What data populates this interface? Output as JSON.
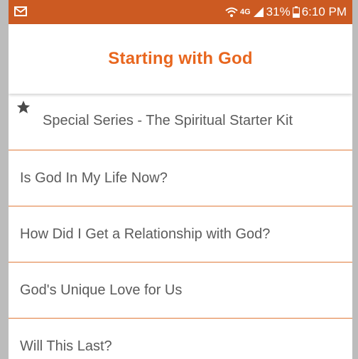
{
  "status_bar": {
    "battery_percent": "31%",
    "time": "6:10 PM",
    "network": "4G"
  },
  "header": {
    "title": "Starting with God"
  },
  "list": {
    "items": [
      {
        "label": "Special Series - The Spiritual Starter Kit",
        "starred": true
      },
      {
        "label": "Is God In My Life Now?"
      },
      {
        "label": "How Did I Get a Relationship with God?"
      },
      {
        "label": "God's Unique Love for Us"
      },
      {
        "label": "Will This Last?"
      }
    ]
  },
  "colors": {
    "status_bar": "#cc5a22",
    "accent": "#e8661e",
    "divider": "#e07a3a",
    "text": "#5b5b5b"
  },
  "icons": [
    "gmail-icon",
    "wifi-icon",
    "signal-icon",
    "battery-icon",
    "star-icon"
  ]
}
